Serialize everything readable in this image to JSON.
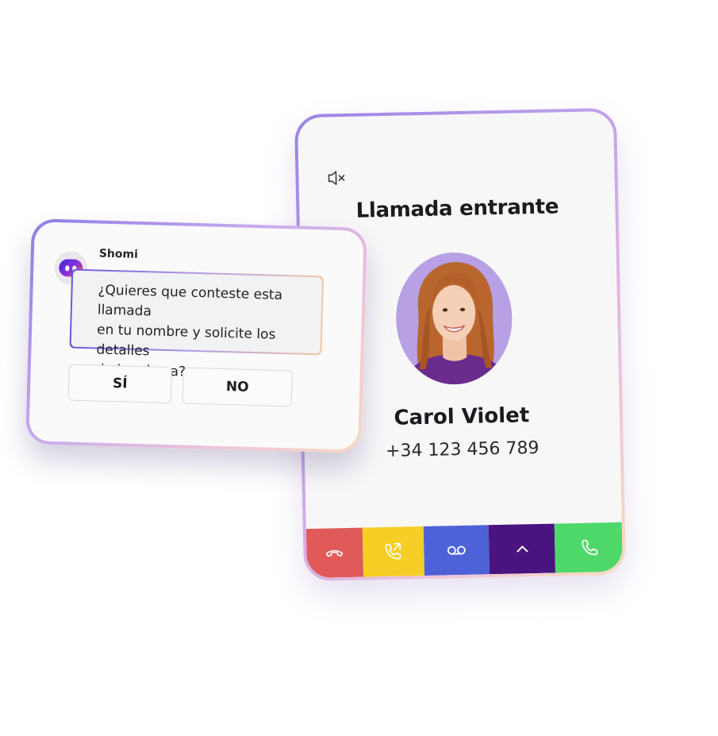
{
  "call": {
    "title": "Llamada entrante",
    "caller_name": "Carol Violet",
    "caller_phone": "+34 123 456 789",
    "mute_icon": "speaker-muted-icon",
    "actions": [
      {
        "id": "reject",
        "icon": "hang-up-icon",
        "color": "#e05a5a"
      },
      {
        "id": "forward",
        "icon": "phone-forward-icon",
        "color": "#f5cf26"
      },
      {
        "id": "voicemail",
        "icon": "voicemail-icon",
        "color": "#4e62d8"
      },
      {
        "id": "more",
        "icon": "chevron-up-icon",
        "color": "#4a1480"
      },
      {
        "id": "accept",
        "icon": "phone-accept-icon",
        "color": "#4fd86a"
      }
    ]
  },
  "prompt": {
    "sender": "Shomi",
    "logo_icon": "shomi-assistant-icon",
    "message_line1": "¿Quieres que conteste esta llamada",
    "message_line2": "en tu nombre y solicite los detalles",
    "message_line3": "de la misma?",
    "yes_label": "SÍ",
    "no_label": "NO"
  },
  "colors": {
    "card_border_start": "#9b84e6",
    "card_border_end": "#f7dcc0",
    "avatar_bg": "#b49ce2",
    "shomi_logo_gradient": [
      "#3a2bd8",
      "#8b2fd6",
      "#ef6a3a"
    ]
  }
}
